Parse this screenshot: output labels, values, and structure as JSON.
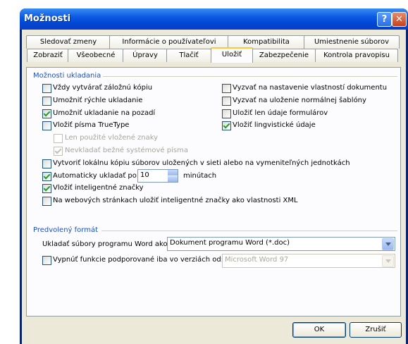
{
  "window": {
    "title": "Možnosti",
    "help_label": "?",
    "close_label": "✕"
  },
  "tabs_row1": [
    "Sledovať zmeny",
    "Informácie o používateľovi",
    "Kompatibilita",
    "Umiestnenie súborov"
  ],
  "tabs_row2": [
    "Zobraziť",
    "Všeobecné",
    "Úpravy",
    "Tlačiť",
    "Uložiť",
    "Zabezpečenie",
    "Kontrola pravopisu"
  ],
  "active_tab": "Uložiť",
  "save_options": {
    "group_label": "Možnosti ukladania",
    "left": [
      {
        "label": "Vždy vytvárať záložnú kópiu",
        "checked": false,
        "enabled": true
      },
      {
        "label": "Umožniť rýchle ukladanie",
        "checked": false,
        "enabled": true
      },
      {
        "label": "Umožniť ukladanie na pozadí",
        "checked": true,
        "enabled": true
      },
      {
        "label": "Vložiť písma TrueType",
        "checked": false,
        "enabled": true
      },
      {
        "label": "Len použité vložené znaky",
        "checked": false,
        "enabled": false
      },
      {
        "label": "Nevkladať bežné systémové písma",
        "checked": true,
        "enabled": false
      }
    ],
    "right": [
      {
        "label": "Vyzvať na nastavenie vlastností dokumentu",
        "checked": false,
        "enabled": true
      },
      {
        "label": "Vyzvať na uloženie normálnej šablóny",
        "checked": false,
        "enabled": true
      },
      {
        "label": "Uložiť len údaje formulárov",
        "checked": false,
        "enabled": true
      },
      {
        "label": "Vložiť lingvistické údaje",
        "checked": true,
        "enabled": true
      }
    ],
    "local_copy": {
      "label": "Vytvoriť lokálnu kópiu súborov uložených v sieti alebo na vymeniteľných jednotkách",
      "checked": false
    },
    "autosave": {
      "label": "Automaticky ukladať po:",
      "checked": true,
      "value": "10",
      "unit": "minútach"
    },
    "smart_tags": {
      "label": "Vložiť inteligentné značky",
      "checked": true
    },
    "xml_tags": {
      "label": "Na webových stránkach uložiť inteligentné značky ako vlastnosti XML",
      "checked": false
    }
  },
  "default_format": {
    "group_label": "Predvolený formát",
    "save_as_label": "Ukladať súbory programu Word ako:",
    "save_as_value": "Dokument programu Word (*.doc)",
    "disable_features": {
      "label": "Vypnúť funkcie podporované iba vo verziách od:",
      "checked": false
    },
    "version_value": "Microsoft Word 97"
  },
  "buttons": {
    "ok": "OK",
    "cancel": "Zrušiť"
  }
}
